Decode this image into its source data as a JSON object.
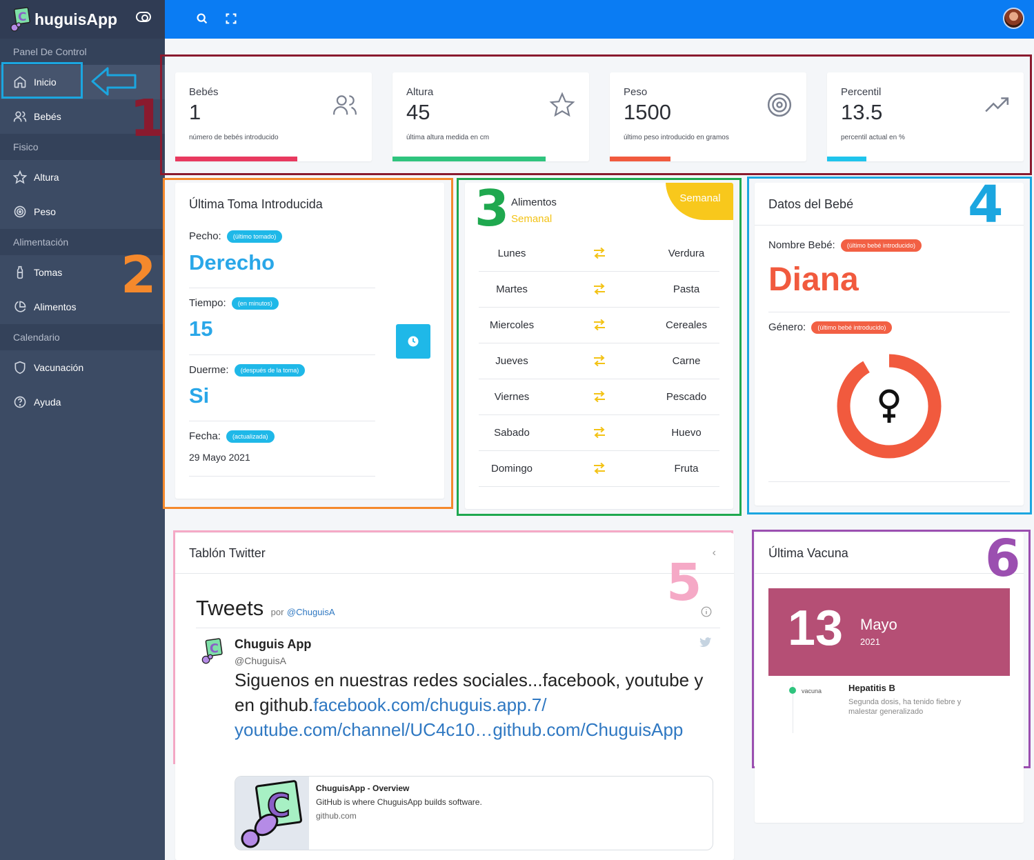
{
  "app": {
    "brand": "huguisApp"
  },
  "sidebar": {
    "sections": {
      "panel": "Panel De Control",
      "fisico": "Fisico",
      "alimentacion": "Alimentación",
      "calendario": "Calendario"
    },
    "items": {
      "inicio": "Inicio",
      "bebes": "Bebés",
      "altura": "Altura",
      "peso": "Peso",
      "tomas": "Tomas",
      "alimentos": "Alimentos",
      "vacunacion": "Vacunación",
      "ayuda": "Ayuda"
    }
  },
  "annotations": [
    "1",
    "2",
    "3",
    "4",
    "5",
    "6"
  ],
  "stats": [
    {
      "label": "Bebés",
      "value": "1",
      "desc": "número de bebés introducido",
      "icon": "users-icon",
      "color": "#e8395f",
      "fill": 0.62
    },
    {
      "label": "Altura",
      "value": "45",
      "desc": "última altura medida en cm",
      "icon": "star-icon",
      "color": "#2fc47e",
      "fill": 0.78
    },
    {
      "label": "Peso",
      "value": "1500",
      "desc": "último peso introducido en gramos",
      "icon": "target-icon",
      "color": "#f15a3e",
      "fill": 0.31
    },
    {
      "label": "Percentil",
      "value": "13.5",
      "desc": "percentil actual en %",
      "icon": "trending-up-icon",
      "color": "#1fc4ec",
      "fill": 0.2
    }
  ],
  "toma": {
    "title": "Última Toma Introducida",
    "pecho_label": "Pecho:",
    "pecho_pill": "(último tomado)",
    "pecho_value": "Derecho",
    "tiempo_label": "Tiempo:",
    "tiempo_pill": "(en minutos)",
    "tiempo_value": "15",
    "duerme_label": "Duerme:",
    "duerme_pill": "(después de la toma)",
    "duerme_value": "Si",
    "fecha_label": "Fecha:",
    "fecha_pill": "(actualizada)",
    "fecha_value": "29 Mayo 2021"
  },
  "alimentos": {
    "title": "Alimentos",
    "subtitle": "Semanal",
    "ribbon": "Semanal",
    "rows": [
      {
        "day": "Lunes",
        "food": "Verdura"
      },
      {
        "day": "Martes",
        "food": "Pasta"
      },
      {
        "day": "Miercoles",
        "food": "Cereales"
      },
      {
        "day": "Jueves",
        "food": "Carne"
      },
      {
        "day": "Viernes",
        "food": "Pescado"
      },
      {
        "day": "Sabado",
        "food": "Huevo"
      },
      {
        "day": "Domingo",
        "food": "Fruta"
      }
    ]
  },
  "bebe": {
    "title": "Datos del Bebé",
    "nombre_label": "Nombre Bebé:",
    "nombre_pill": "(último bebé introducido)",
    "nombre_value": "Diana",
    "genero_label": "Género:",
    "genero_pill": "(último bebé introducido)",
    "accent": "#f15a3e"
  },
  "twitter": {
    "title": "Tablón Twitter",
    "tweets_heading": "Tweets",
    "by": "por",
    "handle_link": "@ChuguisA",
    "author_name": "Chuguis App",
    "author_handle": "@ChuguisA",
    "text": "Siguenos en nuestras redes sociales...facebook, youtube y en github.",
    "link1": "facebook.com/chuguis.app.7/",
    "link2": "youtube.com/channel/UC4c10…github.com/ChuguisApp",
    "preview_title": "ChuguisApp - Overview",
    "preview_desc": "GitHub is where ChuguisApp builds software.",
    "preview_domain": "github.com"
  },
  "vacuna": {
    "title": "Última Vacuna",
    "day": "13",
    "month": "Mayo",
    "year": "2021",
    "tag": "vacuna",
    "name": "Hepatitis B",
    "desc": "Segunda dosis, ha tenido fiebre y malestar generalizado",
    "banner_color": "#b54f75"
  }
}
